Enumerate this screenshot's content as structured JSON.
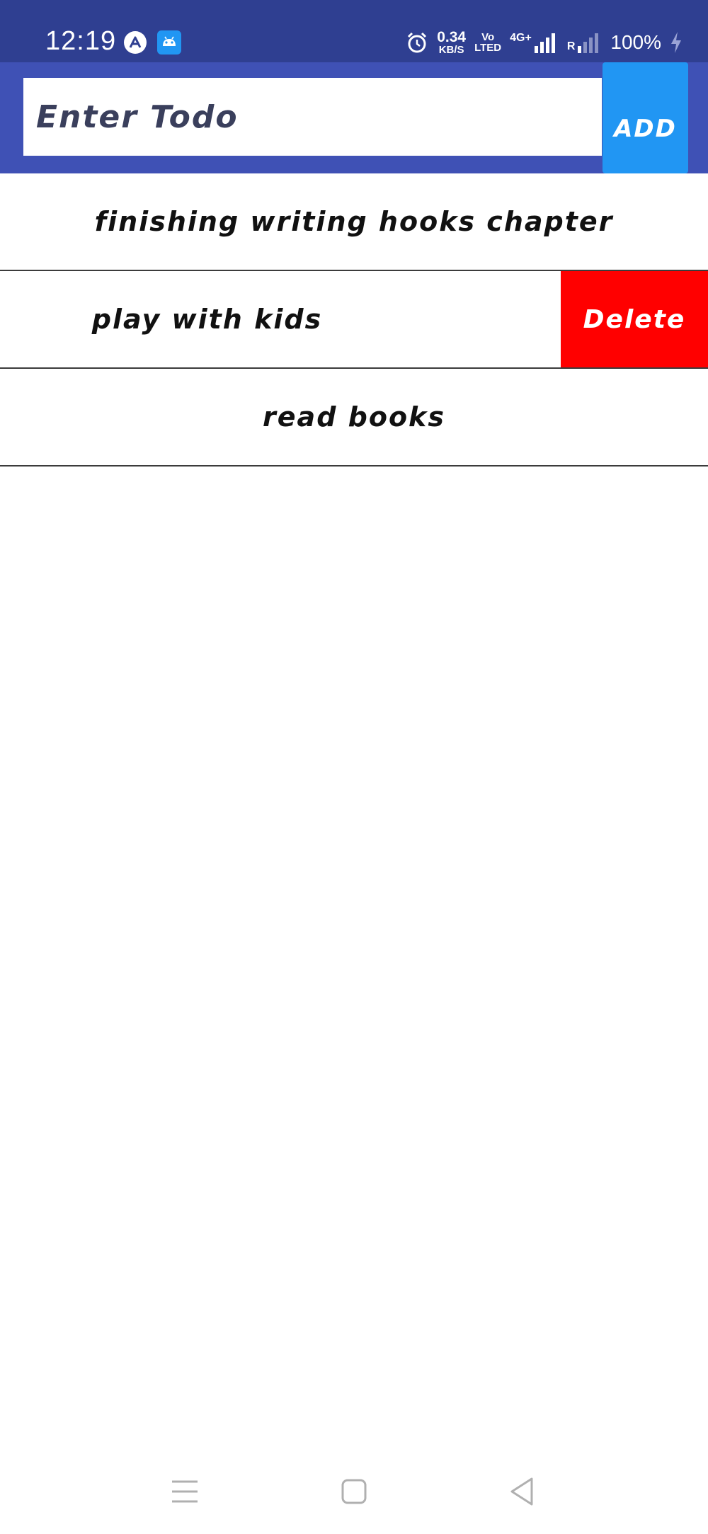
{
  "status_bar": {
    "time": "12:19",
    "left_icons": [
      "expo-app-icon",
      "android-icon"
    ],
    "net_speed_value": "0.34",
    "net_speed_unit": "KB/S",
    "volte_top": "Vo",
    "volte_bottom": "LTED",
    "network_type": "4G+",
    "roaming_label": "R",
    "battery": "100%",
    "colors": {
      "background": "#2f3f91"
    }
  },
  "header": {
    "input_placeholder": "Enter Todo",
    "input_value": "",
    "add_label": "ADD",
    "colors": {
      "background": "#3f51b5",
      "add_button": "#2196f3"
    }
  },
  "todos": [
    {
      "text": "finishing writing hooks chapter"
    },
    {
      "text": "play with kids",
      "swiped": true,
      "action_label": "Delete"
    },
    {
      "text": "read books"
    }
  ],
  "colors": {
    "delete": "#ff0000",
    "divider": "#3b3b3b"
  },
  "nav_bar": {
    "icons": [
      "menu-icon",
      "home-icon",
      "back-icon"
    ]
  }
}
